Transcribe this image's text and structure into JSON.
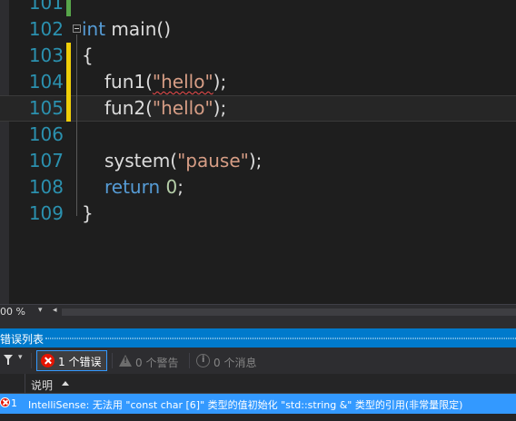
{
  "editor": {
    "lines": [
      {
        "number": "101"
      },
      {
        "number": "102",
        "segments": [
          {
            "t": "int",
            "c": "kw"
          },
          {
            "t": " main()",
            "c": ""
          }
        ]
      },
      {
        "number": "103",
        "segments": [
          {
            "t": "{",
            "c": ""
          }
        ]
      },
      {
        "number": "104",
        "segments": [
          {
            "t": "fun1(",
            "c": ""
          },
          {
            "t": "\"hello\"",
            "c": "str squiggle"
          },
          {
            "t": ");",
            "c": ""
          }
        ]
      },
      {
        "number": "105",
        "segments": [
          {
            "t": "fun2(",
            "c": ""
          },
          {
            "t": "\"hello\"",
            "c": "str"
          },
          {
            "t": ");",
            "c": ""
          }
        ]
      },
      {
        "number": "106",
        "segments": []
      },
      {
        "number": "107",
        "segments": [
          {
            "t": "system(",
            "c": ""
          },
          {
            "t": "\"pause\"",
            "c": "str"
          },
          {
            "t": ");",
            "c": ""
          }
        ]
      },
      {
        "number": "108",
        "segments": [
          {
            "t": "return",
            "c": "kw"
          },
          {
            "t": " ",
            "c": ""
          },
          {
            "t": "0",
            "c": "num"
          },
          {
            "t": ";",
            "c": ""
          }
        ]
      },
      {
        "number": "109",
        "segments": [
          {
            "t": "}",
            "c": ""
          }
        ]
      }
    ]
  },
  "zoom": {
    "value": "00 %"
  },
  "error_list": {
    "title": "错误列表",
    "errors_button": "1 个错误",
    "warnings_label": "0 个警告",
    "messages_label": "0 个消息",
    "column_description": "说明",
    "rows": [
      {
        "number": "1",
        "description": "IntelliSense:  无法用 \"const char [6]\" 类型的值初始化 \"std::string &\" 类型的引用(非常量限定)"
      }
    ]
  },
  "colors": {
    "accent": "#007acc",
    "selection": "#3399ff",
    "error": "#e51400",
    "keyword": "#569cd6",
    "string": "#d69d85",
    "line_number": "#2b91af"
  }
}
